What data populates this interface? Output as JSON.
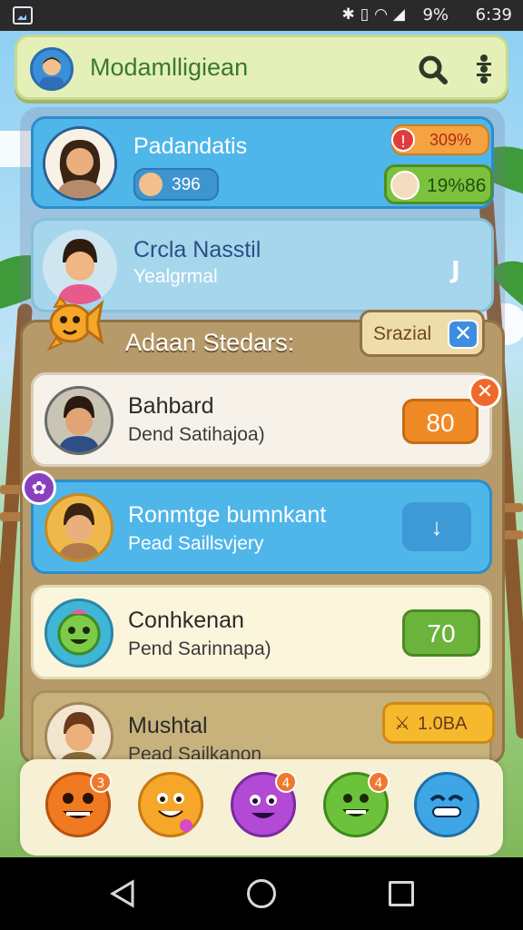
{
  "status_bar": {
    "battery": "9%",
    "time": "6:39"
  },
  "header": {
    "title": "Modamlligiean"
  },
  "top_cards": [
    {
      "name": "Padandatis",
      "chip_value": "396",
      "alert_value": "309%",
      "green_value": "19%86"
    },
    {
      "name": "Crcla Nasstil",
      "sub": "Yealgrmal",
      "action": "J"
    }
  ],
  "section": {
    "title": "Adaan Stedars:",
    "special_label": "Srazial"
  },
  "players": [
    {
      "name": "Bahbard",
      "sub": "Dend Satihajoa)",
      "score": "80"
    },
    {
      "name": "Ronmtge bumnkant",
      "sub": "Pead Saillsvjery",
      "score": "↓"
    },
    {
      "name": "Conhkenan",
      "sub": "Pend Sarinnapa)",
      "score": "70"
    },
    {
      "name": "Mushtal",
      "sub": "Pead Sailkanon",
      "score": "1.0BA"
    }
  ],
  "emoji_bar": [
    {
      "icon": "orange-grin-icon",
      "badge": "3"
    },
    {
      "icon": "yellow-smile-icon",
      "badge": ""
    },
    {
      "icon": "purple-smile-icon",
      "badge": "4"
    },
    {
      "icon": "green-smile-icon",
      "badge": "4"
    },
    {
      "icon": "blue-smile-icon",
      "badge": ""
    }
  ],
  "colors": {
    "header_bg": "#e5f0b9",
    "title_green": "#3a7a2a",
    "card_blue": "#4fb6ea",
    "score_orange": "#f08a26",
    "score_green": "#6cb33c"
  }
}
